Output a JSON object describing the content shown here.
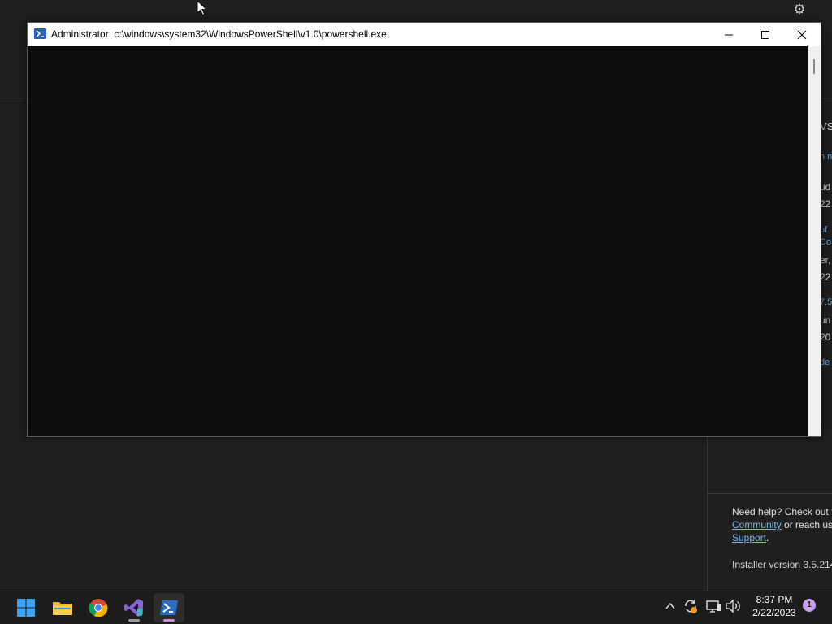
{
  "powershell": {
    "title": "Administrator: c:\\windows\\system32\\WindowsPowerShell\\v1.0\\powershell.exe"
  },
  "background_app": {
    "help_prefix": "Need help? Check out t",
    "help_link_community": "Community",
    "help_mid": " or reach us",
    "help_link_support": "Support",
    "help_suffix": ".",
    "installer_version": "Installer version 3.5.214",
    "right_fragments": [
      "VS",
      "n n",
      "ud",
      "22",
      "of",
      "Co",
      "er,",
      "22",
      "7.5",
      "un",
      "20",
      "de"
    ]
  },
  "taskbar": {
    "apps": [
      "start-icon",
      "file-explorer-icon",
      "chrome-icon",
      "visual-studio-installer-icon",
      "powershell-icon"
    ],
    "clock_time": "8:37 PM",
    "clock_date": "2/22/2023",
    "notification_count": "1"
  },
  "colors": {
    "console_bg": "#0c0c0c",
    "titlebar_bg": "#ffffff",
    "taskbar_bg": "#1c1c1c",
    "link": "#7fb3e6",
    "badge": "#c7a2e8"
  }
}
